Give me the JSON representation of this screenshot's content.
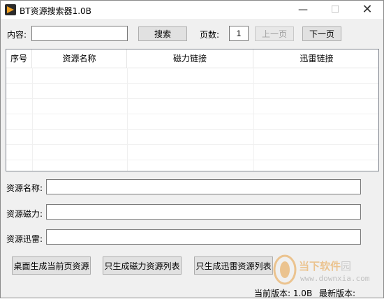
{
  "window": {
    "title": "BT资源搜索器1.0B",
    "min_glyph": "—",
    "max_glyph": "☐",
    "close_glyph": "✕"
  },
  "search": {
    "content_label": "内容:",
    "content_value": "",
    "search_button": "搜索",
    "page_label": "页数:",
    "page_value": "1",
    "prev_button": "上一页",
    "next_button": "下一页"
  },
  "table": {
    "columns": [
      "序号",
      "资源名称",
      "磁力链接",
      "迅雷链接"
    ],
    "rows": []
  },
  "details": {
    "name_label": "资源名称:",
    "name_value": "",
    "magnet_label": "资源磁力:",
    "magnet_value": "",
    "thunder_label": "资源迅雷:",
    "thunder_value": ""
  },
  "actions": {
    "gen_desktop": "桌面生成当前页资源",
    "gen_magnet": "只生成磁力资源列表",
    "gen_thunder": "只生成迅雷资源列表"
  },
  "status": {
    "current_version": "当前版本: 1.0B",
    "latest_version": "最新版本:"
  },
  "watermark": {
    "brand": "当下软件",
    "brand2": "园",
    "url": "www.downxia.com"
  },
  "colors": {
    "window_bg": "#f0f0f0",
    "button_bg": "#e1e1e1",
    "icon_orange": "#f0a020"
  }
}
